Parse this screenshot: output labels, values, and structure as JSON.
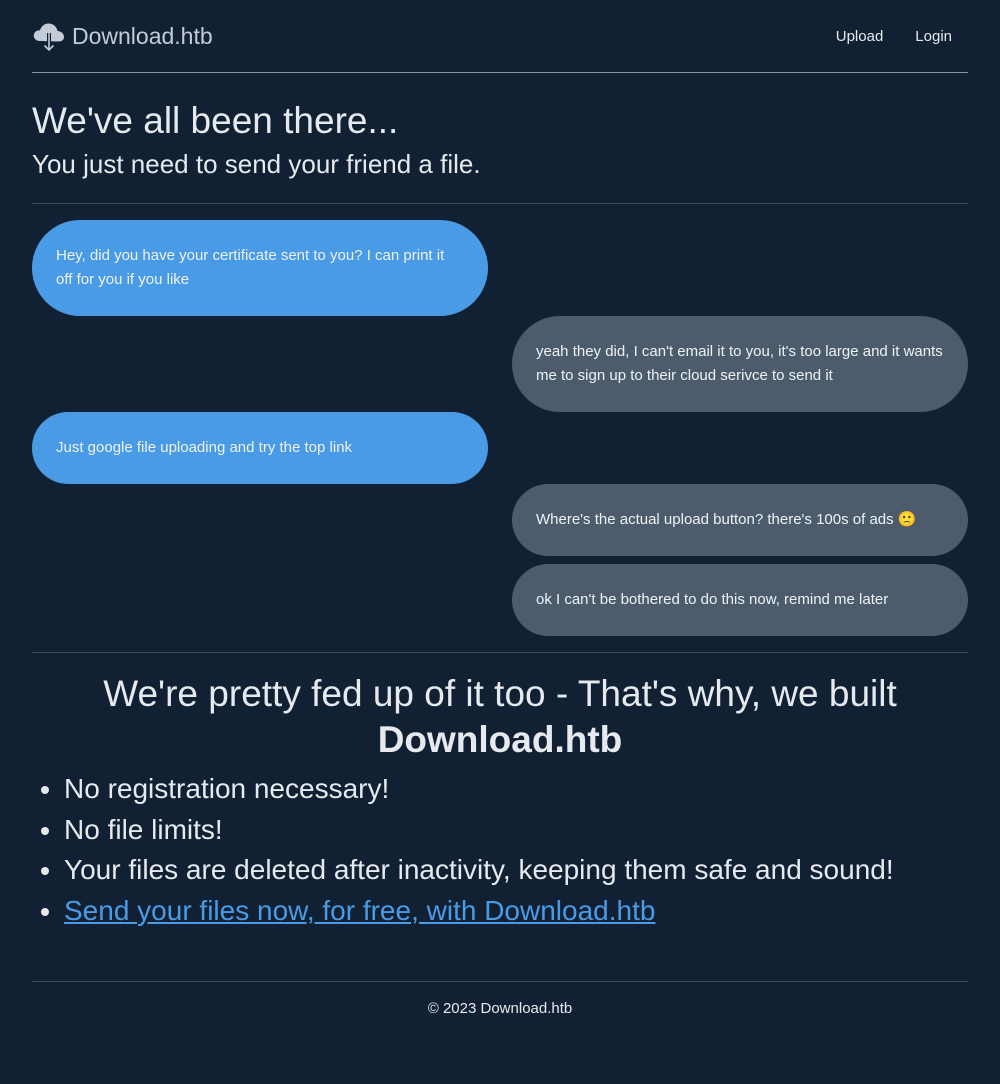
{
  "header": {
    "brand": "Download.htb",
    "brand_icon": "cloud-download-icon",
    "nav": {
      "upload": "Upload",
      "login": "Login"
    }
  },
  "hero": {
    "title": "We've all been there...",
    "subtitle": "You just need to send your friend a file."
  },
  "chat": {
    "messages": [
      {
        "side": "left",
        "text": "Hey, did you have your certificate sent to you? I can print it off for you if you like"
      },
      {
        "side": "right",
        "text": "yeah they did, I can't email it to you, it's too large and it wants me to sign up to their cloud serivce to send it"
      },
      {
        "side": "left",
        "text": "Just google file uploading and try the top link"
      },
      {
        "side": "right",
        "text": "Where's the actual upload button? there's 100s of ads 🙁"
      },
      {
        "side": "right",
        "text": "ok I can't be bothered to do this now, remind me later"
      }
    ]
  },
  "features": {
    "title_line1": "We're pretty fed up of it too - That's why, we built",
    "title_brand": "Download.htb",
    "items": [
      "No registration necessary!",
      "No file limits!",
      "Your files are deleted after inactivity, keeping them safe and sound!"
    ],
    "cta": "Send your files now, for free, with Download.htb"
  },
  "footer": {
    "copyright": "© 2023 Download.htb"
  },
  "colors": {
    "background": "#112133",
    "left_bubble": "#4a9be5",
    "right_bubble": "#4d5c6d",
    "link": "#4a9be5"
  }
}
